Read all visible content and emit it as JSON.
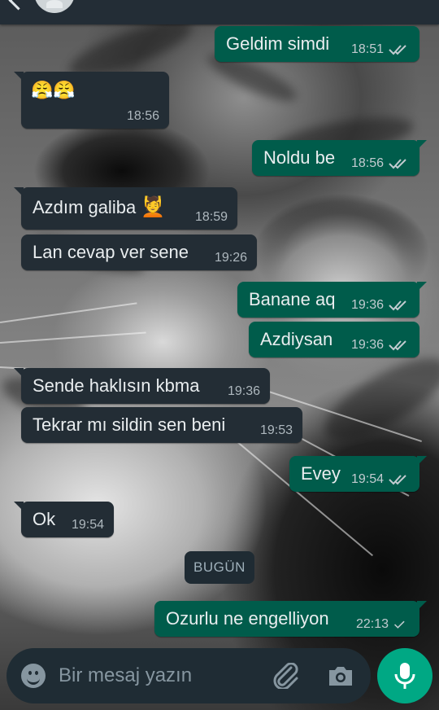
{
  "chat": {
    "messages": [
      {
        "id": "m1",
        "direction": "out",
        "text": "Geldim simdi",
        "time": "18:51",
        "status": "read"
      },
      {
        "id": "m2",
        "direction": "in",
        "text": "😤😤",
        "time": "18:56"
      },
      {
        "id": "m3",
        "direction": "out",
        "text": "Noldu be",
        "time": "18:56",
        "status": "read"
      },
      {
        "id": "m4",
        "direction": "in",
        "text": "Azdım galiba",
        "emoji": "💆",
        "time": "18:59"
      },
      {
        "id": "m5",
        "direction": "in",
        "text": "Lan cevap ver sene",
        "time": "19:26"
      },
      {
        "id": "m6",
        "direction": "out",
        "text": "Banane aq",
        "time": "19:36",
        "status": "read"
      },
      {
        "id": "m7",
        "direction": "out",
        "text": "Azdiysan",
        "time": "19:36",
        "status": "read"
      },
      {
        "id": "m8",
        "direction": "in",
        "text": "Sende haklısın kbma",
        "time": "19:36"
      },
      {
        "id": "m9",
        "direction": "in",
        "text": "Tekrar mı sildin sen beni",
        "time": "19:53"
      },
      {
        "id": "m10",
        "direction": "out",
        "text": "Evey",
        "time": "19:54",
        "status": "read"
      },
      {
        "id": "m11",
        "direction": "in",
        "text": "Ok",
        "time": "19:54"
      },
      {
        "id": "m12",
        "direction": "out",
        "text": "Ozurlu ne engelliyon",
        "time": "22:13",
        "status": "sent"
      }
    ],
    "day_separator": "BUGÜN"
  },
  "composer": {
    "placeholder": "Bir mesaj yazın"
  },
  "icons": {
    "back": "back-arrow-icon",
    "avatar": "contact-avatar",
    "emoji": "emoji-icon",
    "attach": "paperclip-icon",
    "camera": "camera-icon",
    "mic": "microphone-icon",
    "read": "double-check-icon",
    "sent": "single-check-icon"
  },
  "colors": {
    "incoming_bubble": "#232d35",
    "outgoing_bubble": "#005c4b",
    "read_tick": "#c2cbd0",
    "mic_button": "#00a884",
    "composer_bg": "#1f2c34",
    "header_bg": "#232d36"
  }
}
